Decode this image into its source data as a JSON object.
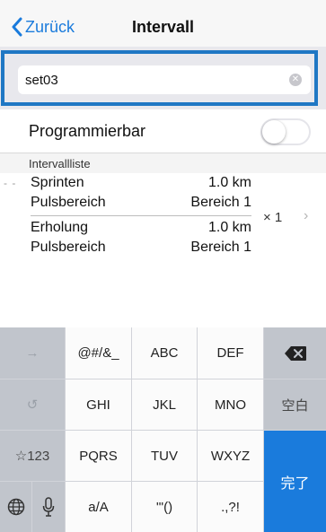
{
  "navbar": {
    "back_label": "Zurück",
    "title": "Intervall"
  },
  "search": {
    "value": "set03"
  },
  "programmable": {
    "label": "Programmierbar",
    "enabled": false
  },
  "list": {
    "header": "Intervallliste",
    "drag_handle": "- -",
    "steps": [
      {
        "name": "Sprinten",
        "value": "1.0 km"
      },
      {
        "name": "Pulsbereich",
        "value": "Bereich 1"
      },
      {
        "name": "Erholung",
        "value": "1.0 km"
      },
      {
        "name": "Pulsbereich",
        "value": "Bereich 1"
      }
    ],
    "repeat": "× 1",
    "chevron": "›"
  },
  "keyboard": {
    "row1": [
      "→",
      "@#/&_",
      "ABC",
      "DEF",
      "⌫"
    ],
    "row2": [
      "↺",
      "GHI",
      "JKL",
      "MNO",
      "空白"
    ],
    "row3": [
      "☆123",
      "PQRS",
      "TUV",
      "WXYZ"
    ],
    "row4": [
      "🌐",
      "🎤",
      "a/A",
      "'\"()",
      ".,?!"
    ],
    "done": "完了"
  }
}
